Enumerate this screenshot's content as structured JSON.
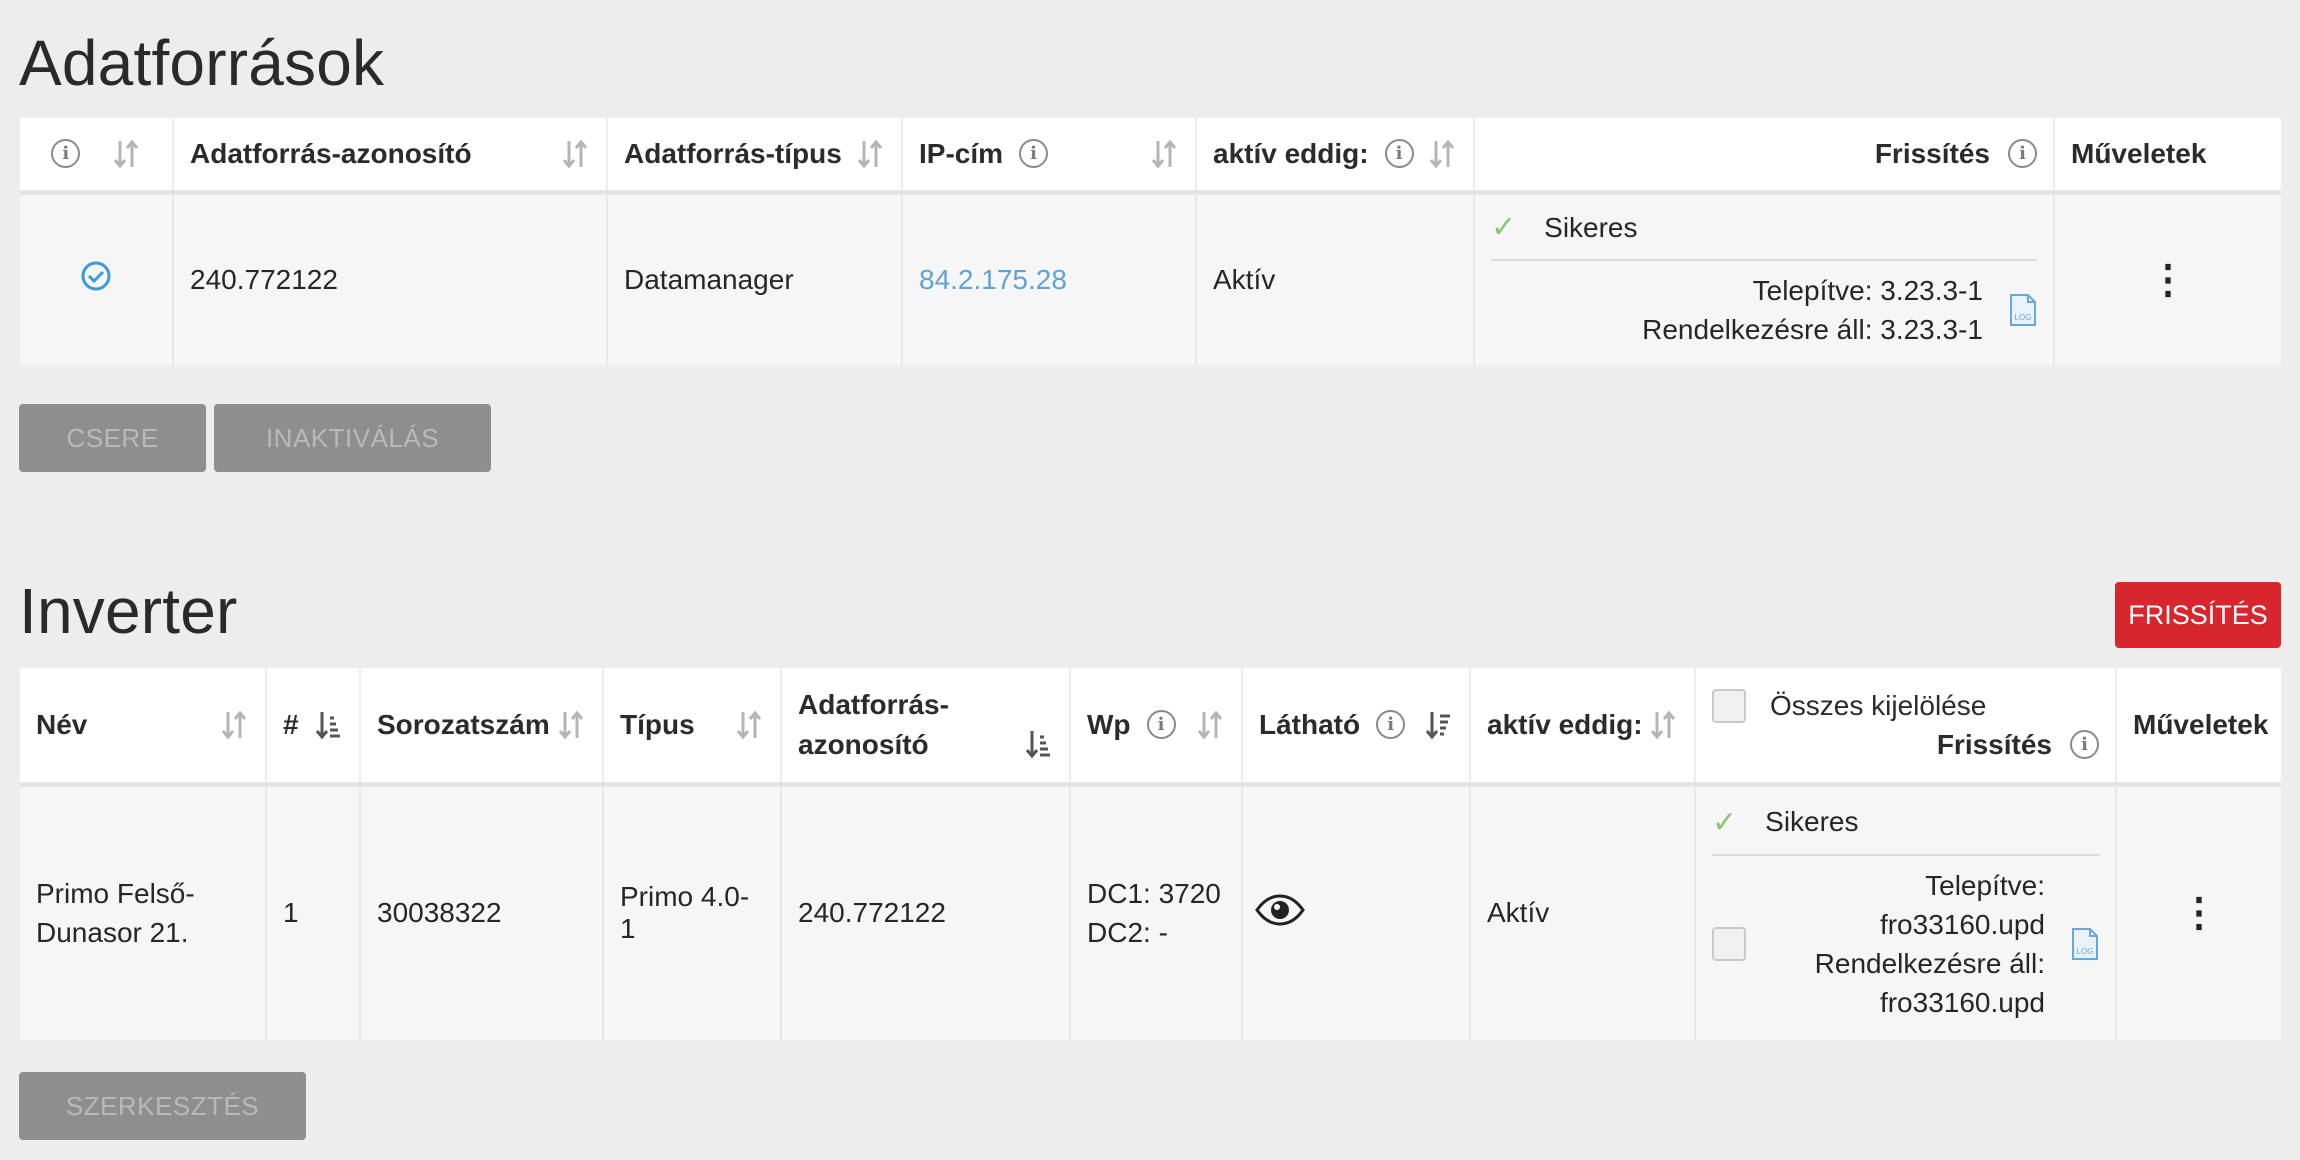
{
  "datasources": {
    "title": "Adatforrások",
    "headers": {
      "id": "Adatforrás-azonosító",
      "type": "Adatforrás-típus",
      "ip": "IP-cím",
      "active": "aktív eddig:",
      "update": "Frissítés",
      "actions": "Műveletek"
    },
    "row": {
      "id": "240.772122",
      "type": "Datamanager",
      "ip": "84.2.175.28",
      "active": "Aktív",
      "update_status": "Sikeres",
      "installed": "Telepítve: 3.23.3-1",
      "available": "Rendelkezésre áll: 3.23.3-1",
      "log_label": "LOG"
    },
    "buttons": {
      "replace": "CSERE",
      "deactivate": "INAKTIVÁLÁS"
    }
  },
  "inverter": {
    "title": "Inverter",
    "refresh_button": "FRISSÍTÉS",
    "headers": {
      "name": "Név",
      "num": "#",
      "serial": "Sorozatszám",
      "type": "Típus",
      "ds_id_line1": "Adatforrás-",
      "ds_id_line2": "azonosító",
      "wp": "Wp",
      "visible": "Látható",
      "active": "aktív eddig:",
      "select_all": "Összes kijelölése",
      "update": "Frissítés",
      "actions": "Műveletek"
    },
    "row": {
      "name_line1": "Primo Felső-",
      "name_line2": "Dunasor 21.",
      "num": "1",
      "serial": "30038322",
      "type": "Primo 4.0-1",
      "ds_id": "240.772122",
      "dc1": "DC1: 3720",
      "dc2": "DC2: -",
      "active": "Aktív",
      "update_status": "Sikeres",
      "installed_label": "Telepítve:",
      "installed_file": "fro33160.upd",
      "available_label": "Rendelkezésre áll:",
      "available_file": "fro33160.upd",
      "log_label": "LOG"
    },
    "buttons": {
      "edit": "SZERKESZTÉS"
    }
  },
  "colors": {
    "accent_blue": "#5fa3d4",
    "success_green": "#8bc57a",
    "danger_red": "#d7262e",
    "disabled_gray": "#8e8e8e"
  }
}
